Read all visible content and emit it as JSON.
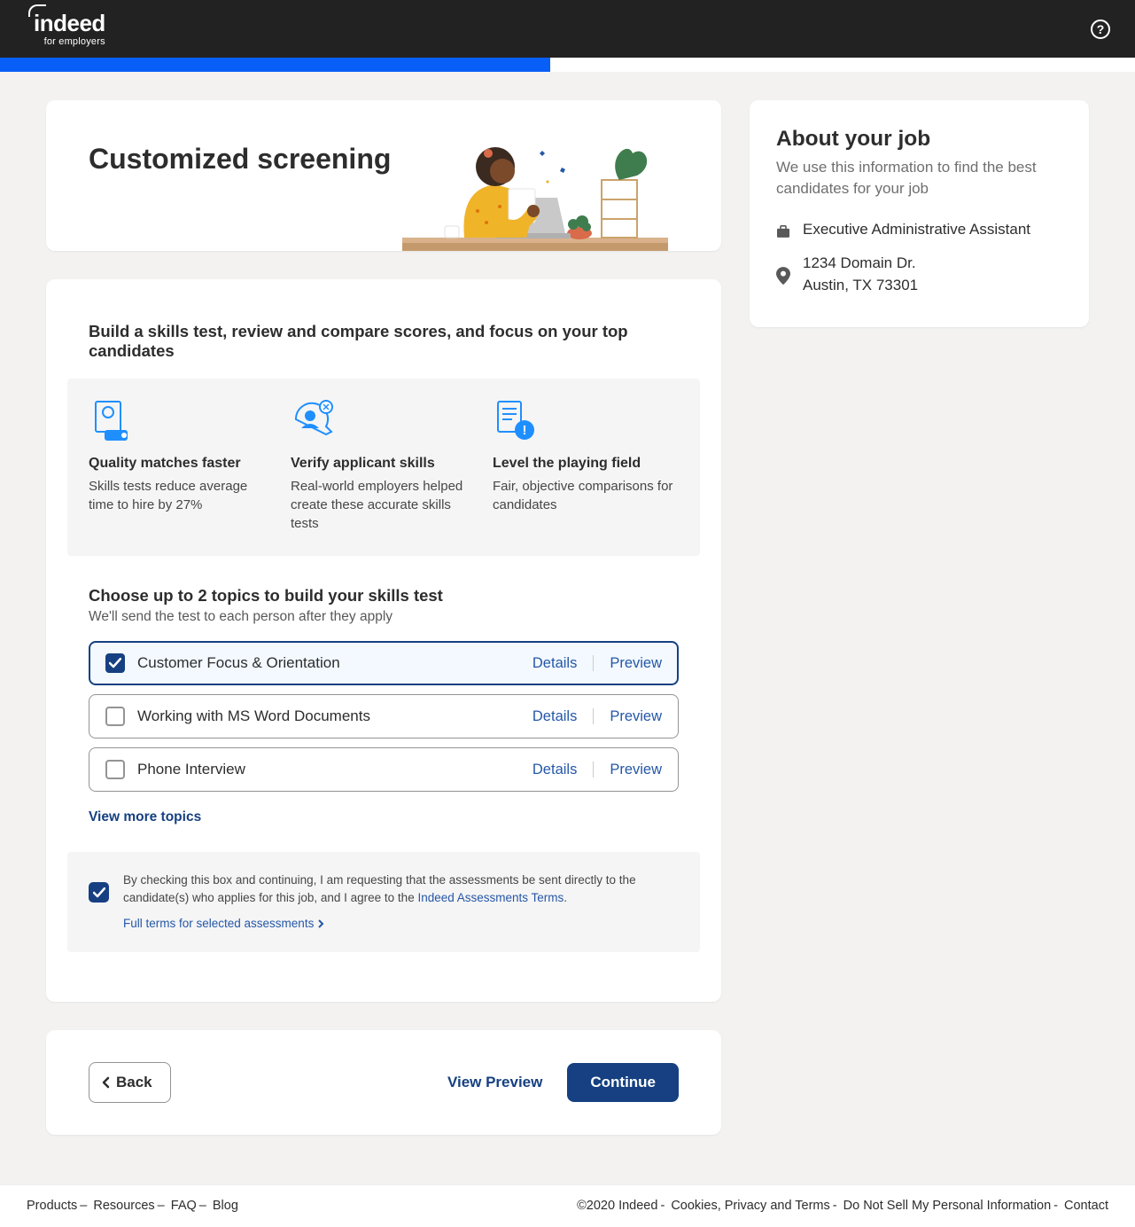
{
  "header": {
    "logo_main": "indeed",
    "logo_sub": "for employers"
  },
  "hero": {
    "title": "Customized screening"
  },
  "side": {
    "title": "About your job",
    "subtitle": "We use this information to find the best candidates for your job",
    "job_title": "Executive Administrative Assistant",
    "addr_line1": "1234 Domain Dr.",
    "addr_line2": "Austin, TX 73301"
  },
  "main": {
    "lead": "Build a skills test, review and compare scores, and focus on your top candidates",
    "benefits": [
      {
        "title": "Quality matches faster",
        "desc": "Skills tests reduce average time to hire by 27%"
      },
      {
        "title": "Verify applicant skills",
        "desc": "Real-world employers helped create these accurate skills tests"
      },
      {
        "title": "Level the playing field",
        "desc": "Fair, objective comparisons for candidates"
      }
    ],
    "topics_heading": "Choose up to 2 topics to build your skills test",
    "topics_sub": "We'll send the test to each person after they apply",
    "topics": [
      {
        "label": "Customer Focus & Orientation",
        "selected": true
      },
      {
        "label": "Working with MS Word Documents",
        "selected": false
      },
      {
        "label": "Phone Interview",
        "selected": false
      }
    ],
    "details_label": "Details",
    "preview_label": "Preview",
    "view_more": "View more topics",
    "consent_text_a": "By checking this box and continuing, I am requesting that the assessments be sent directly to the candidate(s) who applies for this job, and I agree to the ",
    "consent_link": "Indeed Assessments Terms",
    "consent_text_b": ".",
    "full_terms": "Full terms for selected assessments"
  },
  "nav": {
    "back": "Back",
    "view_preview": "View Preview",
    "continue": "Continue"
  },
  "footer": {
    "left": [
      "Products",
      "Resources",
      "FAQ",
      "Blog"
    ],
    "copyright": "©2020 Indeed",
    "right": [
      "Cookies, Privacy and Terms",
      "Do Not Sell My Personal Information",
      "Contact"
    ]
  }
}
